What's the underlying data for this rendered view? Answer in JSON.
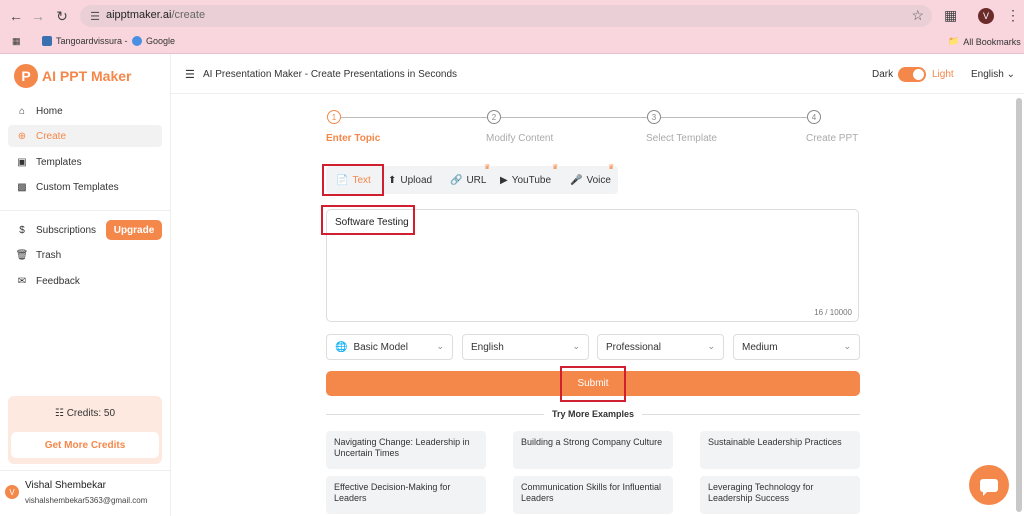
{
  "browser": {
    "url_host": "aipptmaker.ai",
    "url_path": "/create",
    "profile_initial": "V",
    "bookmarks": [
      "Tangoardvissura -",
      "Google"
    ],
    "all_bookmarks": "All Bookmarks"
  },
  "sidebar": {
    "logo_letter": "P",
    "logo_text": "AI PPT Maker",
    "items": [
      {
        "label": "Home",
        "icon": "home-icon"
      },
      {
        "label": "Create",
        "icon": "plus-circle-icon"
      },
      {
        "label": "Templates",
        "icon": "templates-icon"
      },
      {
        "label": "Custom Templates",
        "icon": "custom-templates-icon"
      }
    ],
    "items2": [
      {
        "label": "Subscriptions",
        "icon": "dollar-icon"
      },
      {
        "label": "Trash",
        "icon": "trash-icon"
      },
      {
        "label": "Feedback",
        "icon": "feedback-icon"
      }
    ],
    "upgrade_label": "Upgrade",
    "credits_label": "Credits: 50",
    "get_credits_label": "Get More Credits",
    "user_initial": "V",
    "user_name": "Vishal Shembekar",
    "user_email": "vishalshembekar5363@gmail.com"
  },
  "header": {
    "title": "AI Presentation Maker - Create Presentations in Seconds",
    "dark_label": "Dark",
    "light_label": "Light",
    "language": "English"
  },
  "steps": [
    {
      "num": "1",
      "label": "Enter Topic"
    },
    {
      "num": "2",
      "label": "Modify Content"
    },
    {
      "num": "3",
      "label": "Select Template"
    },
    {
      "num": "4",
      "label": "Create PPT"
    }
  ],
  "tabs": [
    "Text",
    "Upload",
    "URL",
    "YouTube",
    "Voice"
  ],
  "input": {
    "value": "Software Testing",
    "counter": "16 / 10000"
  },
  "selects": [
    "Basic Model",
    "English",
    "Professional",
    "Medium"
  ],
  "submit_label": "Submit",
  "examples_title": "Try More Examples",
  "examples": [
    "Navigating Change: Leadership in Uncertain Times",
    "Building a Strong Company Culture",
    "Sustainable Leadership Practices",
    "Effective Decision-Making for Leaders",
    "Communication Skills for Influential Leaders",
    "Leveraging Technology for Leadership Success"
  ],
  "colors": {
    "accent": "#f4874a",
    "highlight": "#d02030",
    "chrome": "#f9d6de"
  }
}
